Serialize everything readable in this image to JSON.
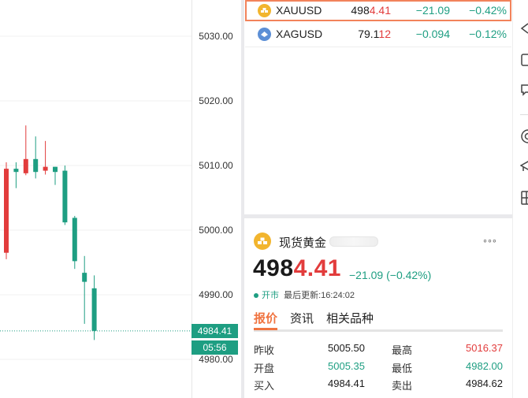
{
  "chart": {
    "y_axis_ticks": [
      "5030.00",
      "5020.00",
      "5010.00",
      "5000.00",
      "4990.00",
      "4980.00"
    ],
    "current_price_label": "4984.41",
    "countdown_label": "05:56",
    "colors": {
      "up": "#e23c3c",
      "down": "#1e9e82"
    }
  },
  "chart_data": {
    "type": "candlestick",
    "ylim": [
      4975,
      5036
    ],
    "tick_values": [
      5030,
      5020,
      5010,
      5000,
      4990,
      4980
    ],
    "candles": [
      {
        "open": 4996.5,
        "close": 5009.5,
        "high": 5010.5,
        "low": 4995.5
      },
      {
        "open": 5009.5,
        "close": 5009.0,
        "high": 5010.5,
        "low": 5006.5
      },
      {
        "open": 5008.8,
        "close": 5011.0,
        "high": 5016.2,
        "low": 5008.5
      },
      {
        "open": 5011.0,
        "close": 5009.0,
        "high": 5014.5,
        "low": 5008.0
      },
      {
        "open": 5009.2,
        "close": 5009.8,
        "high": 5013.8,
        "low": 5008.6
      },
      {
        "open": 5009.8,
        "close": 5009.0,
        "high": 5009.8,
        "low": 5007.0
      },
      {
        "open": 5009.2,
        "close": 5001.2,
        "high": 5010.0,
        "low": 5000.8
      },
      {
        "open": 5001.9,
        "close": 4995.2,
        "high": 5002.2,
        "low": 4994.0
      },
      {
        "open": 4993.4,
        "close": 4992.0,
        "high": 4996.0,
        "low": 4985.5
      },
      {
        "open": 4991.0,
        "close": 4984.41,
        "high": 4993.0,
        "low": 4983.0
      }
    ],
    "last_price": 4984.41
  },
  "watchlist": [
    {
      "symbol": "XAUUSD",
      "price_prefix": "498",
      "price_suffix": "4.41",
      "change": "−21.09",
      "percent": "−0.42%",
      "selected": true
    },
    {
      "symbol": "XAGUSD",
      "price_prefix": "79.1",
      "price_suffix": "12",
      "change": "−0.094",
      "percent": "−0.12%",
      "selected": false
    }
  ],
  "detail": {
    "title": "现货黄金",
    "more": "◦◦◦",
    "price_prefix": "498",
    "price_suffix": "4.41",
    "change": "−21.09 (−0.42%)",
    "market_status": "开市",
    "last_update": "最后更新:16:24:02",
    "tabs": [
      "报价",
      "资讯",
      "相关品种"
    ],
    "stats": {
      "prev_close_label": "昨收",
      "prev_close": "5005.50",
      "high_label": "最高",
      "high": "5016.37",
      "open_label": "开盘",
      "open": "5005.35",
      "low_label": "最低",
      "low": "4982.00",
      "bid_label": "买入",
      "bid": "4984.41",
      "ask_label": "卖出",
      "ask": "4984.62"
    }
  },
  "toolbar_icons": [
    "back-arrow-icon",
    "square-icon",
    "message-icon",
    "target-icon",
    "graduation-icon",
    "grid-icon"
  ]
}
